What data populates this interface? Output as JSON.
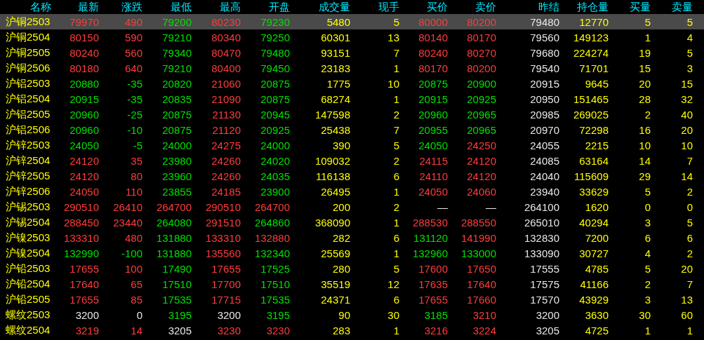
{
  "table": {
    "columns": [
      {
        "label": "名称",
        "kind": "name"
      },
      {
        "label": "最新",
        "kind": "price"
      },
      {
        "label": "涨跌",
        "kind": "change"
      },
      {
        "label": "最低",
        "kind": "price"
      },
      {
        "label": "最高",
        "kind": "price"
      },
      {
        "label": "开盘",
        "kind": "price"
      },
      {
        "label": "成交量",
        "kind": "volume"
      },
      {
        "label": "现手",
        "kind": "volume"
      },
      {
        "label": "买价",
        "kind": "price"
      },
      {
        "label": "卖价",
        "kind": "price"
      },
      {
        "label": "昨结",
        "kind": "prev"
      },
      {
        "label": "持仓量",
        "kind": "volume"
      },
      {
        "label": "买量",
        "kind": "volume"
      },
      {
        "label": "卖量",
        "kind": "volume"
      }
    ],
    "rows": [
      {
        "selected": true,
        "cells": [
          "沪铜2503",
          "79970",
          "490",
          "79200",
          "80230",
          "79230",
          "5480",
          "5",
          "80000",
          "80200",
          "79480",
          "12770",
          "5",
          "5"
        ]
      },
      {
        "selected": false,
        "cells": [
          "沪铜2504",
          "80150",
          "590",
          "79210",
          "80340",
          "79250",
          "60301",
          "13",
          "80140",
          "80170",
          "79560",
          "149123",
          "1",
          "4"
        ]
      },
      {
        "selected": false,
        "cells": [
          "沪铜2505",
          "80240",
          "560",
          "79340",
          "80470",
          "79480",
          "93151",
          "7",
          "80240",
          "80270",
          "79680",
          "224274",
          "19",
          "5"
        ]
      },
      {
        "selected": false,
        "cells": [
          "沪铜2506",
          "80180",
          "640",
          "79210",
          "80400",
          "79450",
          "23183",
          "1",
          "80170",
          "80200",
          "79540",
          "71701",
          "15",
          "3"
        ]
      },
      {
        "selected": false,
        "cells": [
          "沪铝2503",
          "20880",
          "-35",
          "20820",
          "21060",
          "20875",
          "1775",
          "10",
          "20875",
          "20900",
          "20915",
          "9645",
          "20",
          "15"
        ]
      },
      {
        "selected": false,
        "cells": [
          "沪铝2504",
          "20915",
          "-35",
          "20835",
          "21090",
          "20875",
          "68274",
          "1",
          "20915",
          "20925",
          "20950",
          "151465",
          "28",
          "32"
        ]
      },
      {
        "selected": false,
        "cells": [
          "沪铝2505",
          "20960",
          "-25",
          "20875",
          "21130",
          "20945",
          "147598",
          "2",
          "20960",
          "20965",
          "20985",
          "269025",
          "2",
          "40"
        ]
      },
      {
        "selected": false,
        "cells": [
          "沪铝2506",
          "20960",
          "-10",
          "20875",
          "21120",
          "20925",
          "25438",
          "7",
          "20955",
          "20965",
          "20970",
          "72298",
          "16",
          "20"
        ]
      },
      {
        "selected": false,
        "cells": [
          "沪锌2503",
          "24050",
          "-5",
          "24000",
          "24275",
          "24000",
          "390",
          "5",
          "24050",
          "24250",
          "24055",
          "2215",
          "10",
          "10"
        ]
      },
      {
        "selected": false,
        "cells": [
          "沪锌2504",
          "24120",
          "35",
          "23980",
          "24260",
          "24020",
          "109032",
          "2",
          "24115",
          "24120",
          "24085",
          "63164",
          "14",
          "7"
        ]
      },
      {
        "selected": false,
        "cells": [
          "沪锌2505",
          "24120",
          "80",
          "23960",
          "24260",
          "24035",
          "116138",
          "6",
          "24110",
          "24120",
          "24040",
          "115609",
          "29",
          "14"
        ]
      },
      {
        "selected": false,
        "cells": [
          "沪锌2506",
          "24050",
          "110",
          "23855",
          "24185",
          "23900",
          "26495",
          "1",
          "24050",
          "24060",
          "23940",
          "33629",
          "5",
          "2"
        ]
      },
      {
        "selected": false,
        "cells": [
          "沪锡2503",
          "290510",
          "26410",
          "264700",
          "290510",
          "264700",
          "200",
          "2",
          "—",
          "—",
          "264100",
          "1620",
          "0",
          "0"
        ]
      },
      {
        "selected": false,
        "cells": [
          "沪锡2504",
          "288450",
          "23440",
          "264080",
          "291510",
          "264860",
          "368090",
          "1",
          "288530",
          "288550",
          "265010",
          "40294",
          "3",
          "5"
        ]
      },
      {
        "selected": false,
        "cells": [
          "沪镍2503",
          "133310",
          "480",
          "131880",
          "133310",
          "132880",
          "282",
          "6",
          "131120",
          "141990",
          "132830",
          "7200",
          "6",
          "6"
        ]
      },
      {
        "selected": false,
        "cells": [
          "沪镍2504",
          "132990",
          "-100",
          "131880",
          "135560",
          "132340",
          "25569",
          "1",
          "132960",
          "133000",
          "133090",
          "30727",
          "4",
          "2"
        ]
      },
      {
        "selected": false,
        "cells": [
          "沪铅2503",
          "17655",
          "100",
          "17490",
          "17655",
          "17525",
          "280",
          "5",
          "17600",
          "17650",
          "17555",
          "4785",
          "5",
          "20"
        ]
      },
      {
        "selected": false,
        "cells": [
          "沪铅2504",
          "17640",
          "65",
          "17510",
          "17700",
          "17510",
          "35519",
          "12",
          "17635",
          "17640",
          "17575",
          "41166",
          "2",
          "7"
        ]
      },
      {
        "selected": false,
        "cells": [
          "沪铅2505",
          "17655",
          "85",
          "17535",
          "17715",
          "17535",
          "24371",
          "6",
          "17655",
          "17660",
          "17570",
          "43929",
          "3",
          "13"
        ]
      },
      {
        "selected": false,
        "cells": [
          "螺纹2503",
          "3200",
          "0",
          "3195",
          "3200",
          "3195",
          "90",
          "30",
          "3185",
          "3210",
          "3200",
          "3630",
          "30",
          "60"
        ]
      },
      {
        "selected": false,
        "cells": [
          "螺纹2504",
          "3219",
          "14",
          "3205",
          "3230",
          "3230",
          "283",
          "1",
          "3216",
          "3224",
          "3205",
          "4725",
          "1",
          "1"
        ]
      }
    ]
  }
}
